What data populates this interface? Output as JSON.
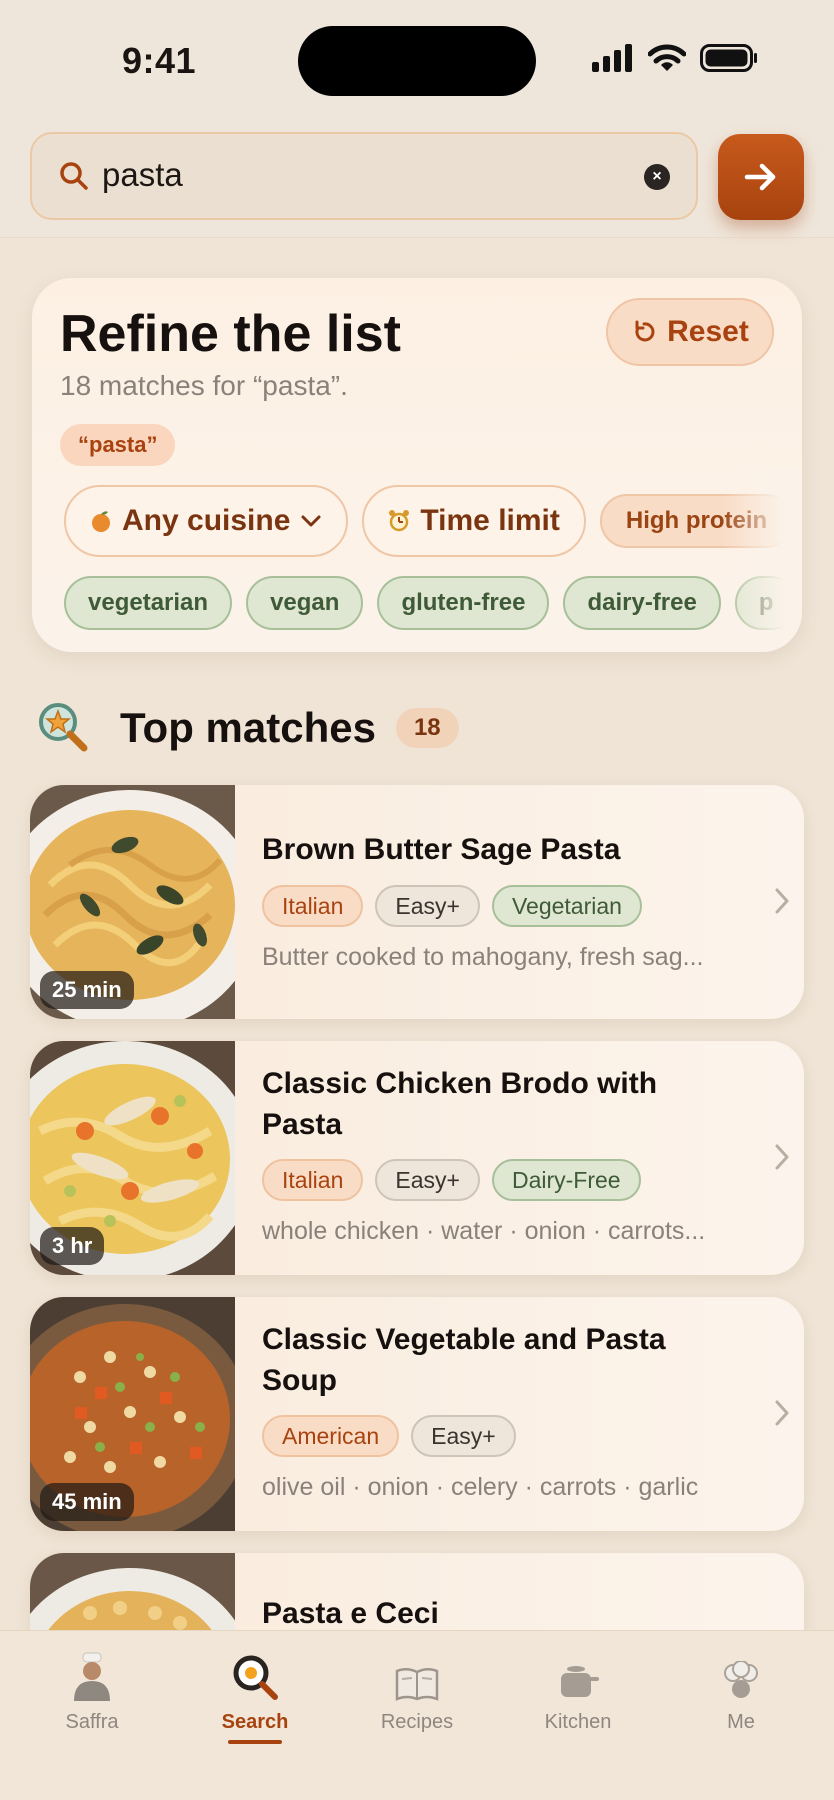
{
  "status_bar": {
    "time": "9:41"
  },
  "search": {
    "query": "pasta",
    "go_icon": "arrow-right-icon"
  },
  "refine": {
    "title": "Refine the list",
    "subtitle": "18 matches for “pasta”.",
    "reset_label": "Reset",
    "query_chip": "“pasta”",
    "filters": {
      "cuisine": "Any cuisine",
      "time": "Time limit",
      "protein": "High protein"
    },
    "diets": [
      "vegetarian",
      "vegan",
      "gluten-free",
      "dairy-free",
      "p"
    ]
  },
  "matches": {
    "title": "Top matches",
    "count": "18",
    "recipes": [
      {
        "title": "Brown Butter Sage Pasta",
        "time": "25 min",
        "tags": [
          "Italian",
          "Easy+",
          "Vegetarian"
        ],
        "description": "Butter cooked to mahogany, fresh sag..."
      },
      {
        "title": "Classic Chicken Brodo with Pasta",
        "time": "3 hr",
        "tags": [
          "Italian",
          "Easy+",
          "Dairy-Free"
        ],
        "description": "whole chicken · water · onion · carrots..."
      },
      {
        "title": "Classic Vegetable and Pasta Soup",
        "time": "45 min",
        "tags": [
          "American",
          "Easy+"
        ],
        "description": "olive oil · onion · celery · carrots · garlic"
      },
      {
        "title": "Pasta e Ceci"
      }
    ]
  },
  "tab_bar": {
    "items": [
      {
        "label": "Saffra",
        "icon": "chef-avatar-icon"
      },
      {
        "label": "Search",
        "icon": "search-icon"
      },
      {
        "label": "Recipes",
        "icon": "book-icon"
      },
      {
        "label": "Kitchen",
        "icon": "pot-icon"
      },
      {
        "label": "Me",
        "icon": "chef-hat-icon"
      }
    ],
    "active": "Search"
  },
  "colors": {
    "accent": "#a8430f",
    "diet_green": "#3f5a37",
    "background": "#efe4d6"
  }
}
